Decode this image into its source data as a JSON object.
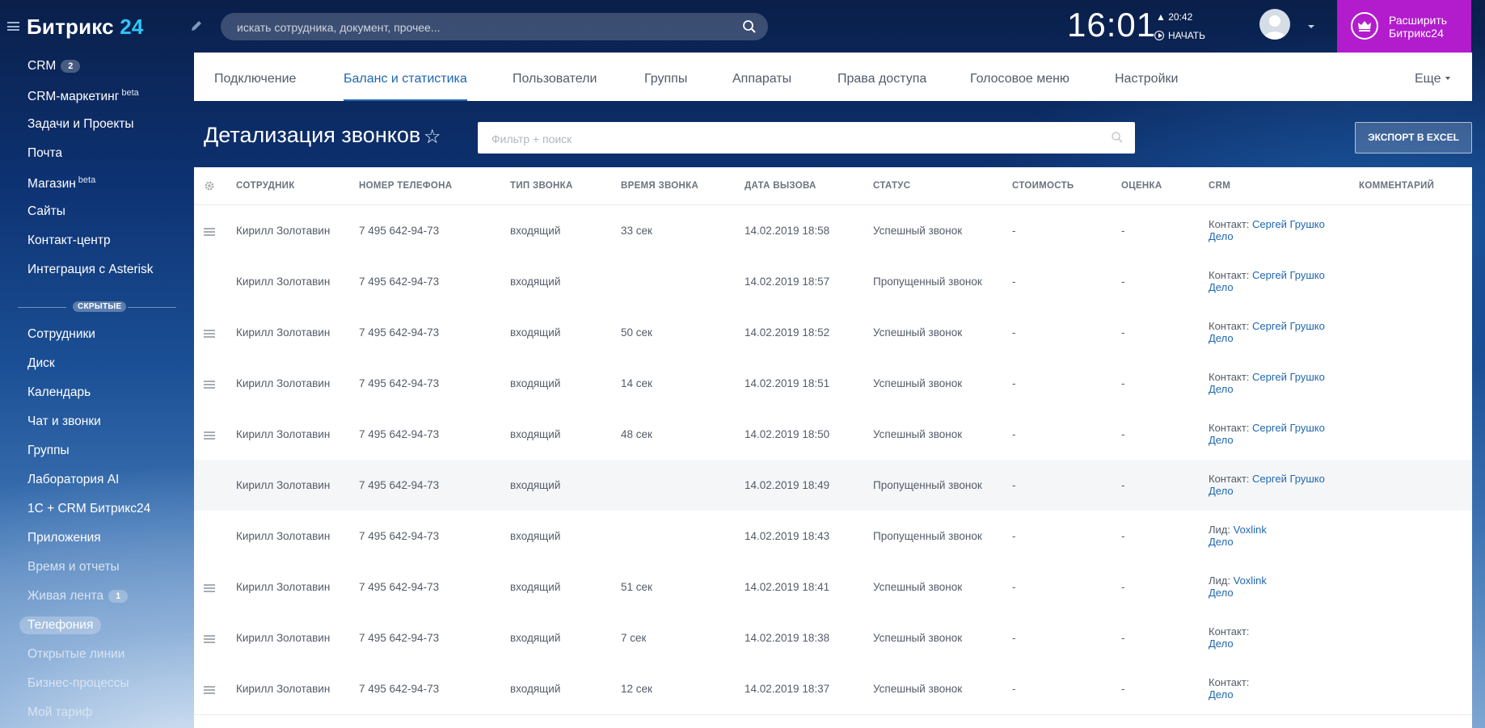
{
  "app": {
    "logo_main": "Битрикс",
    "logo_num": "24",
    "search_placeholder": "искать сотрудника, документ, прочее...",
    "clock": "16:01",
    "alarm_time": "20:42",
    "start_label": "НАЧАТЬ",
    "upgrade_line1": "Расширить",
    "upgrade_line2": "Битрикс24",
    "brand_color": "#2fc6f6",
    "upgrade_color": "#b21ccd"
  },
  "leftmenu": {
    "items": [
      {
        "label": "CRM",
        "badge": "2"
      },
      {
        "label": "CRM-маркетинг",
        "sup": "beta"
      },
      {
        "label": "Задачи и Проекты"
      },
      {
        "label": "Почта"
      },
      {
        "label": "Магазин",
        "sup": "beta"
      },
      {
        "label": "Сайты"
      },
      {
        "label": "Контакт-центр"
      },
      {
        "label": "Интеграция с Asterisk"
      }
    ],
    "hidden_label": "СКРЫТЫЕ",
    "hidden_items": [
      {
        "label": "Сотрудники"
      },
      {
        "label": "Диск"
      },
      {
        "label": "Календарь"
      },
      {
        "label": "Чат и звонки"
      },
      {
        "label": "Группы"
      },
      {
        "label": "Лаборатория AI"
      },
      {
        "label": "1С + CRM Битрикс24"
      },
      {
        "label": "Приложения"
      },
      {
        "label": "Время и отчеты"
      },
      {
        "label": "Живая лента",
        "badge": "1"
      },
      {
        "label": "Телефония",
        "active": true
      },
      {
        "label": "Открытые линии"
      },
      {
        "label": "Бизнес-процессы"
      },
      {
        "label": "Мой тариф"
      }
    ]
  },
  "tabs": {
    "items": [
      "Подключение",
      "Баланс и статистика",
      "Пользователи",
      "Группы",
      "Аппараты",
      "Права доступа",
      "Голосовое меню",
      "Настройки"
    ],
    "active": "Баланс и статистика",
    "more": "Еще"
  },
  "page": {
    "title": "Детализация звонков",
    "filter_placeholder": "Фильтр + поиск",
    "export_label": "ЭКСПОРТ В EXCEL"
  },
  "grid": {
    "columns": [
      "СОТРУДНИК",
      "НОМЕР ТЕЛЕФОНА",
      "ТИП ЗВОНКА",
      "ВРЕМЯ ЗВОНКА",
      "ДАТА ВЫЗОВА",
      "СТАТУС",
      "СТОИМОСТЬ",
      "ОЦЕНКА",
      "CRM",
      "КОММЕНТАРИЙ"
    ],
    "rows": [
      {
        "employee": "Кирилл Золотавин",
        "phone": "7 495 642-94-73",
        "type": "входящий",
        "duration": "33 сек",
        "date": "14.02.2019 18:58",
        "status": "Успешный звонок",
        "cost": "-",
        "rating": "-",
        "crm_prefix": "Контакт:",
        "crm_name": "Сергей Грушко",
        "crm_deal": "Дело",
        "record": true
      },
      {
        "employee": "Кирилл Золотавин",
        "phone": "7 495 642-94-73",
        "type": "входящий",
        "duration": "",
        "date": "14.02.2019 18:57",
        "status": "Пропущенный звонок",
        "cost": "-",
        "rating": "-",
        "crm_prefix": "Контакт:",
        "crm_name": "Сергей Грушко",
        "crm_deal": "Дело",
        "record": false
      },
      {
        "employee": "Кирилл Золотавин",
        "phone": "7 495 642-94-73",
        "type": "входящий",
        "duration": "50 сек",
        "date": "14.02.2019 18:52",
        "status": "Успешный звонок",
        "cost": "-",
        "rating": "-",
        "crm_prefix": "Контакт:",
        "crm_name": "Сергей Грушко",
        "crm_deal": "Дело",
        "record": true
      },
      {
        "employee": "Кирилл Золотавин",
        "phone": "7 495 642-94-73",
        "type": "входящий",
        "duration": "14 сек",
        "date": "14.02.2019 18:51",
        "status": "Успешный звонок",
        "cost": "-",
        "rating": "-",
        "crm_prefix": "Контакт:",
        "crm_name": "Сергей Грушко",
        "crm_deal": "Дело",
        "record": true
      },
      {
        "employee": "Кирилл Золотавин",
        "phone": "7 495 642-94-73",
        "type": "входящий",
        "duration": "48 сек",
        "date": "14.02.2019 18:50",
        "status": "Успешный звонок",
        "cost": "-",
        "rating": "-",
        "crm_prefix": "Контакт:",
        "crm_name": "Сергей Грушко",
        "crm_deal": "Дело",
        "record": true
      },
      {
        "employee": "Кирилл Золотавин",
        "phone": "7 495 642-94-73",
        "type": "входящий",
        "duration": "",
        "date": "14.02.2019 18:49",
        "status": "Пропущенный звонок",
        "cost": "-",
        "rating": "-",
        "crm_prefix": "Контакт:",
        "crm_name": "Сергей Грушко",
        "crm_deal": "Дело",
        "record": false,
        "alt": true
      },
      {
        "employee": "Кирилл Золотавин",
        "phone": "7 495 642-94-73",
        "type": "входящий",
        "duration": "",
        "date": "14.02.2019 18:43",
        "status": "Пропущенный звонок",
        "cost": "-",
        "rating": "-",
        "crm_prefix": "Лид:",
        "crm_name": "Voxlink",
        "crm_deal": "Дело",
        "record": false
      },
      {
        "employee": "Кирилл Золотавин",
        "phone": "7 495 642-94-73",
        "type": "входящий",
        "duration": "51 сек",
        "date": "14.02.2019 18:41",
        "status": "Успешный звонок",
        "cost": "-",
        "rating": "-",
        "crm_prefix": "Лид:",
        "crm_name": "Voxlink",
        "crm_deal": "Дело",
        "record": true
      },
      {
        "employee": "Кирилл Золотавин",
        "phone": "7 495 642-94-73",
        "type": "входящий",
        "duration": "7 сек",
        "date": "14.02.2019 18:38",
        "status": "Успешный звонок",
        "cost": "-",
        "rating": "-",
        "crm_prefix": "Контакт:",
        "crm_name": "",
        "crm_deal": "Дело",
        "record": true
      },
      {
        "employee": "Кирилл Золотавин",
        "phone": "7 495 642-94-73",
        "type": "входящий",
        "duration": "12 сек",
        "date": "14.02.2019 18:37",
        "status": "Успешный звонок",
        "cost": "-",
        "rating": "-",
        "crm_prefix": "Контакт:",
        "crm_name": "",
        "crm_deal": "Дело",
        "record": true
      }
    ]
  }
}
